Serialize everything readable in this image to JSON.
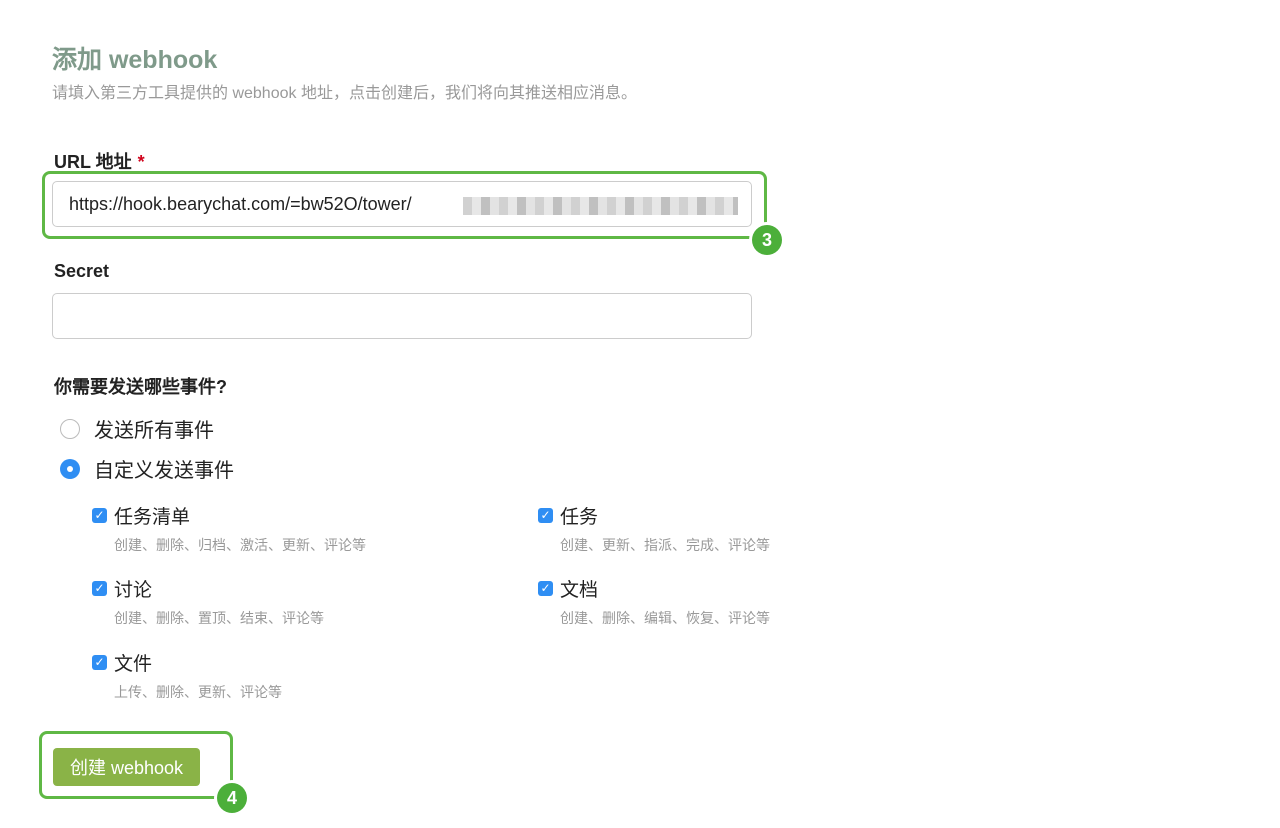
{
  "header": {
    "title": "添加 webhook",
    "subtitle": "请填入第三方工具提供的 webhook 地址，点击创建后，我们将向其推送相应消息。"
  },
  "url_field": {
    "label": "URL 地址",
    "required_mark": "*",
    "value": "https://hook.bearychat.com/=bw52O/tower/"
  },
  "secret_field": {
    "label": "Secret",
    "value": ""
  },
  "events": {
    "question": "你需要发送哪些事件?",
    "options": [
      {
        "label": "发送所有事件",
        "checked": false
      },
      {
        "label": "自定义发送事件",
        "checked": true
      }
    ],
    "items": [
      {
        "name": "任务清单",
        "desc": "创建、删除、归档、激活、更新、评论等",
        "checked": true
      },
      {
        "name": "任务",
        "desc": "创建、更新、指派、完成、评论等",
        "checked": true
      },
      {
        "name": "讨论",
        "desc": "创建、删除、置顶、结束、评论等",
        "checked": true
      },
      {
        "name": "文档",
        "desc": "创建、删除、编辑、恢复、评论等",
        "checked": true
      },
      {
        "name": "文件",
        "desc": "上传、删除、更新、评论等",
        "checked": true
      }
    ]
  },
  "submit": {
    "label": "创建 webhook"
  },
  "annotations": {
    "step_url": "3",
    "step_submit": "4",
    "color": "#5fb845"
  },
  "colors": {
    "accent": "#2f8ef3",
    "button": "#8ab347",
    "title": "#7f9a8a"
  }
}
